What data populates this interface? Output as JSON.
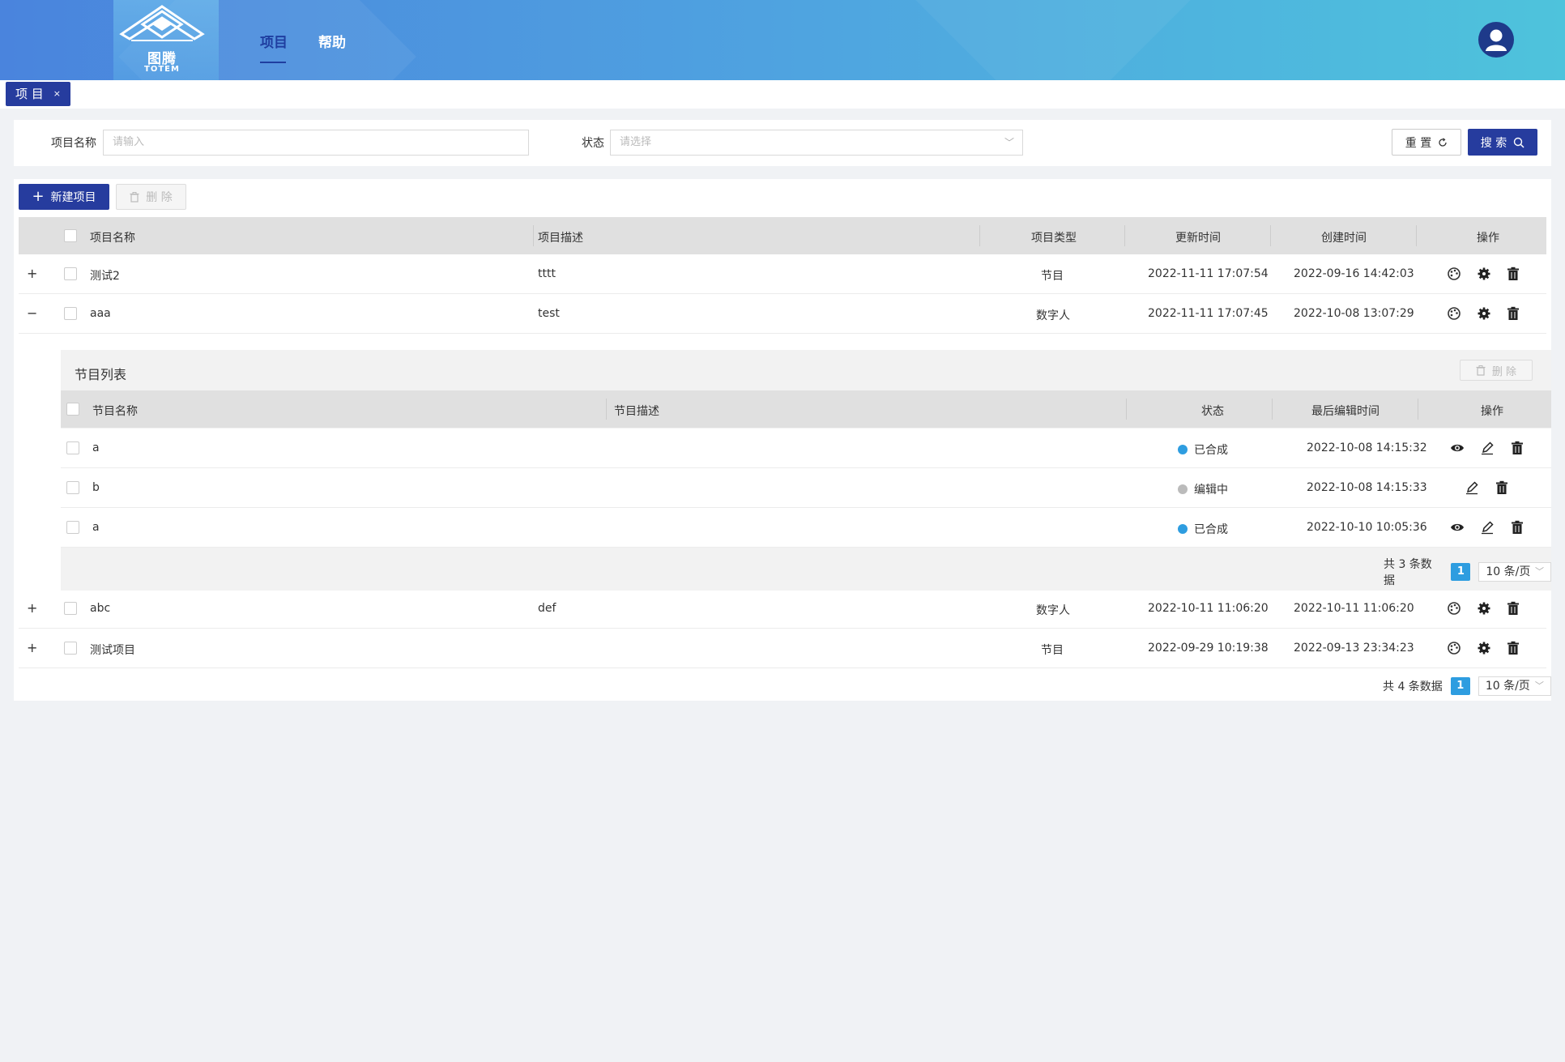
{
  "header": {
    "logo_text": "图腾",
    "logo_sub": "TOTEM",
    "nav": [
      {
        "label": "项目",
        "active": true
      },
      {
        "label": "帮助",
        "active": false
      }
    ],
    "accent": "#263c9e"
  },
  "tabs": [
    {
      "label": "项 目",
      "close": "×"
    }
  ],
  "filter": {
    "name_label": "项目名称",
    "name_placeholder": "请输入",
    "status_label": "状态",
    "status_placeholder": "请选择",
    "reset_label": "重 置",
    "search_label": "搜 索"
  },
  "toolbar": {
    "new_label": "新建项目",
    "delete_label": "删 除"
  },
  "table": {
    "columns": [
      "项目名称",
      "项目描述",
      "项目类型",
      "更新时间",
      "创建时间",
      "操作"
    ],
    "rows": [
      {
        "expander": "+",
        "name": "测试2",
        "desc": "tttt",
        "type": "节目",
        "updated": "2022-11-11 17:07:54",
        "created": "2022-09-16 14:42:03"
      },
      {
        "expander": "−",
        "name": "aaa",
        "desc": "test",
        "type": "数字人",
        "updated": "2022-11-11 17:07:45",
        "created": "2022-10-08 13:07:29"
      },
      {
        "expander": "+",
        "name": "abc",
        "desc": "def",
        "type": "数字人",
        "updated": "2022-10-11 11:06:20",
        "created": "2022-10-11 11:06:20"
      },
      {
        "expander": "+",
        "name": "测试项目",
        "desc": "",
        "type": "节目",
        "updated": "2022-09-29 10:19:38",
        "created": "2022-09-13 23:34:23"
      }
    ],
    "pager": {
      "total_text": "共 4 条数据",
      "page": "1",
      "size": "10 条/页"
    }
  },
  "sub_table": {
    "title": "节目列表",
    "delete_label": "删 除",
    "columns": [
      "节目名称",
      "节目描述",
      "状态",
      "最后编辑时间",
      "操作"
    ],
    "rows": [
      {
        "name": "a",
        "desc": "",
        "status": "已合成",
        "status_kind": "done",
        "time": "2022-10-08 14:15:32"
      },
      {
        "name": "b",
        "desc": "",
        "status": "编辑中",
        "status_kind": "editing",
        "time": "2022-10-08 14:15:33"
      },
      {
        "name": "a",
        "desc": "",
        "status": "已合成",
        "status_kind": "done",
        "time": "2022-10-10 10:05:36"
      }
    ],
    "pager": {
      "total_text": "共 3 条数据",
      "page": "1",
      "size": "10 条/页"
    }
  }
}
